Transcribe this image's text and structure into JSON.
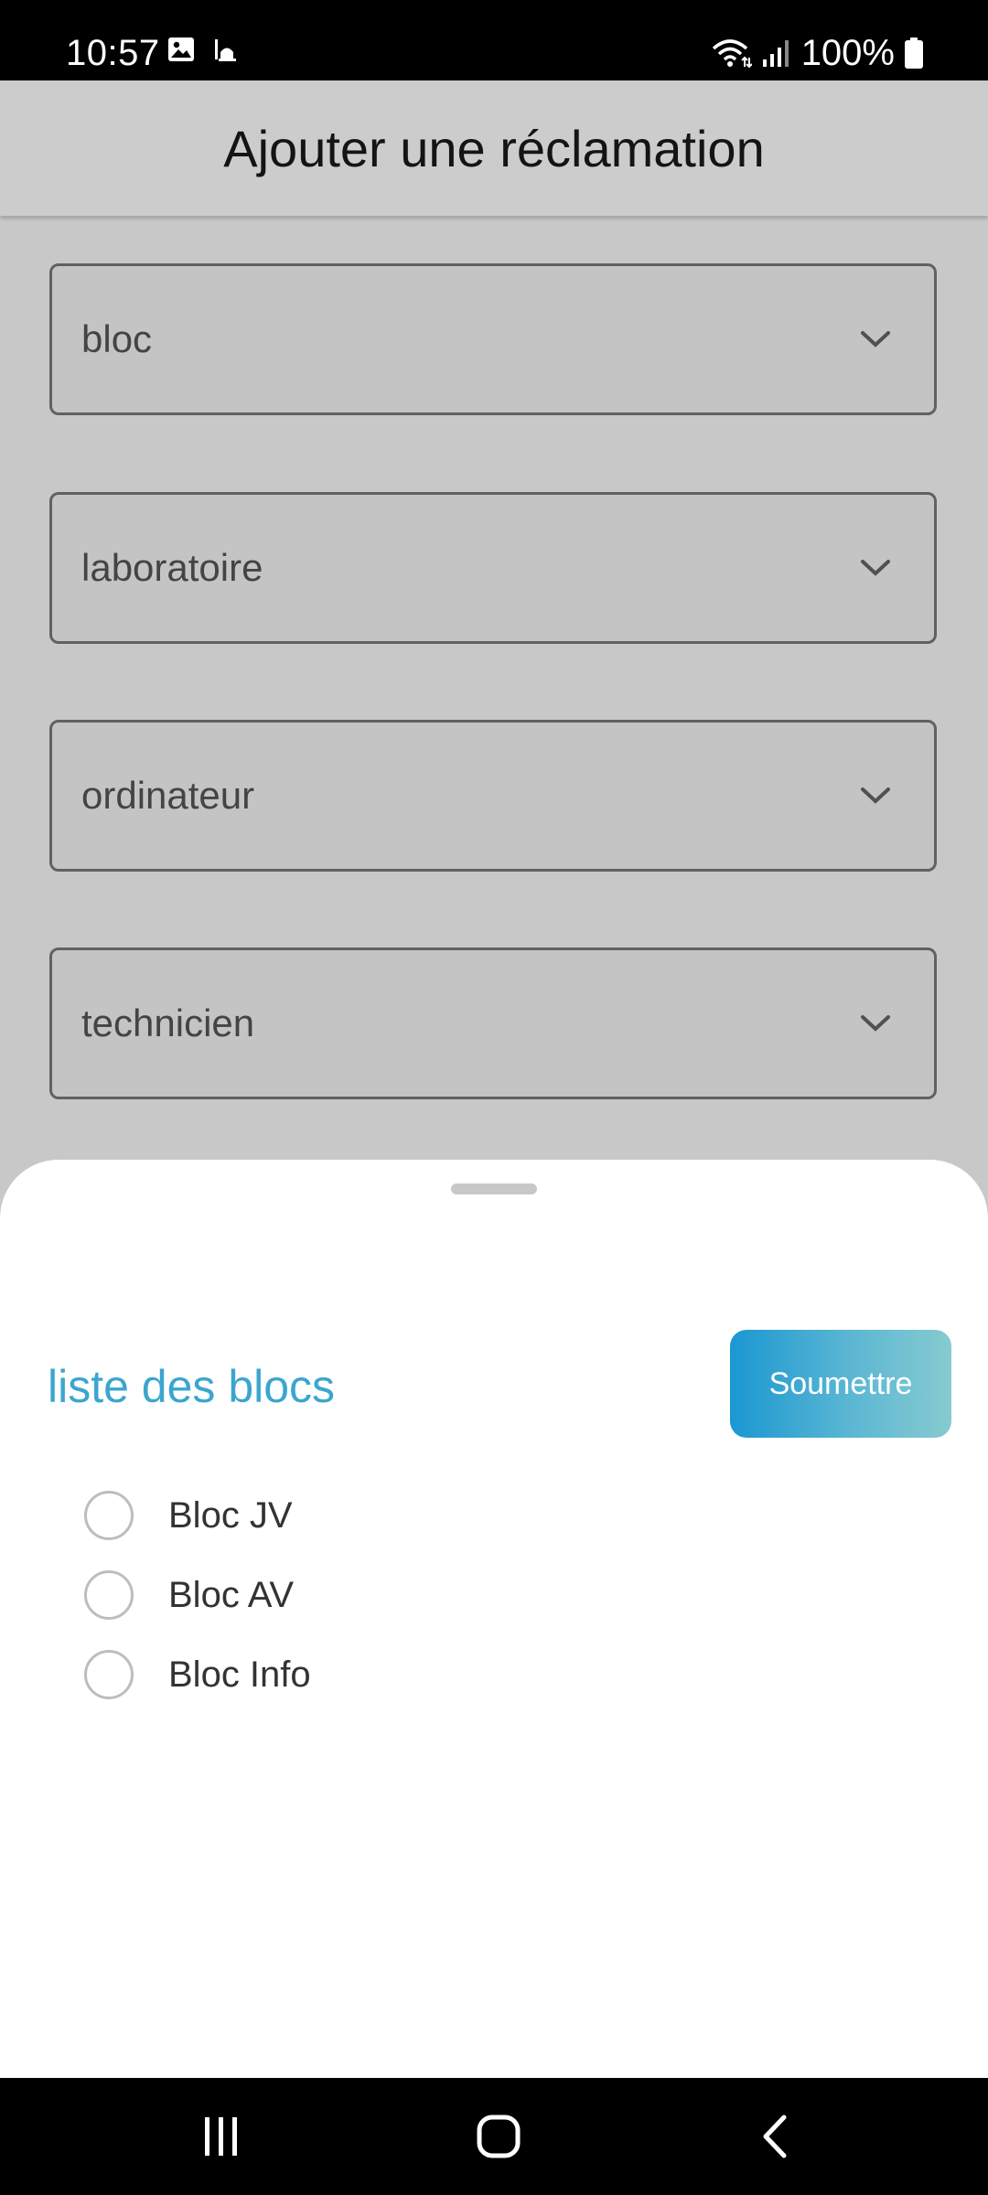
{
  "status_bar": {
    "time": "10:57",
    "battery_percent": "100%",
    "left_icons": [
      "gallery-icon",
      "mosque-icon"
    ],
    "right_icons": [
      "wifi-icon",
      "signal-icon",
      "battery-icon"
    ]
  },
  "app_bar": {
    "title": "Ajouter une réclamation"
  },
  "form": {
    "dropdowns": [
      {
        "value": "bloc"
      },
      {
        "value": "laboratoire"
      },
      {
        "value": "ordinateur"
      },
      {
        "value": "technicien"
      }
    ]
  },
  "sheet": {
    "title": "liste des blocs",
    "submit_label": "Soumettre",
    "options": [
      {
        "label": "Bloc JV",
        "selected": false
      },
      {
        "label": "Bloc AV",
        "selected": false
      },
      {
        "label": "Bloc Info",
        "selected": false
      }
    ]
  },
  "nav_bar": {
    "buttons": [
      "recent-apps-icon",
      "home-icon",
      "back-icon"
    ]
  },
  "colors": {
    "accent": "#3aa6cf",
    "button_gradient_start": "#1a97d2",
    "button_gradient_end": "#86cbd0"
  }
}
